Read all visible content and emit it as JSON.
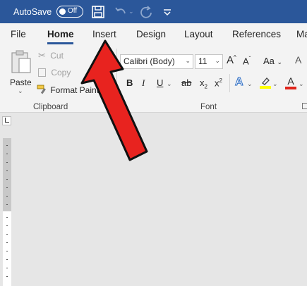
{
  "titlebar": {
    "autosave_label": "AutoSave",
    "autosave_state": "Off",
    "icons": [
      "save-icon",
      "undo-icon",
      "redo-icon",
      "customize-quick-access-icon"
    ]
  },
  "tabs": [
    "File",
    "Home",
    "Insert",
    "Design",
    "Layout",
    "References",
    "Ma"
  ],
  "active_tab": "Home",
  "clipboard": {
    "paste_label": "Paste",
    "cut_label": "Cut",
    "copy_label": "Copy",
    "format_painter_label": "Format Painter",
    "group_label": "Clipboard"
  },
  "font": {
    "font_name": "Calibri (Body)",
    "font_size": "11",
    "grow_label": "A",
    "shrink_label": "A",
    "change_case_label": "Aa",
    "bold_label": "B",
    "italic_label": "I",
    "underline_label": "U",
    "strike_label": "ab",
    "subscript_label": "x",
    "superscript_label": "x",
    "group_label": "Font"
  },
  "colors": {
    "title_bar": "#2b579a",
    "ribbon_bg": "#f3f3f3",
    "arrow_fill": "#e8231f",
    "highlight_yellow": "#ffff00",
    "font_color_red": "#e0251b"
  }
}
